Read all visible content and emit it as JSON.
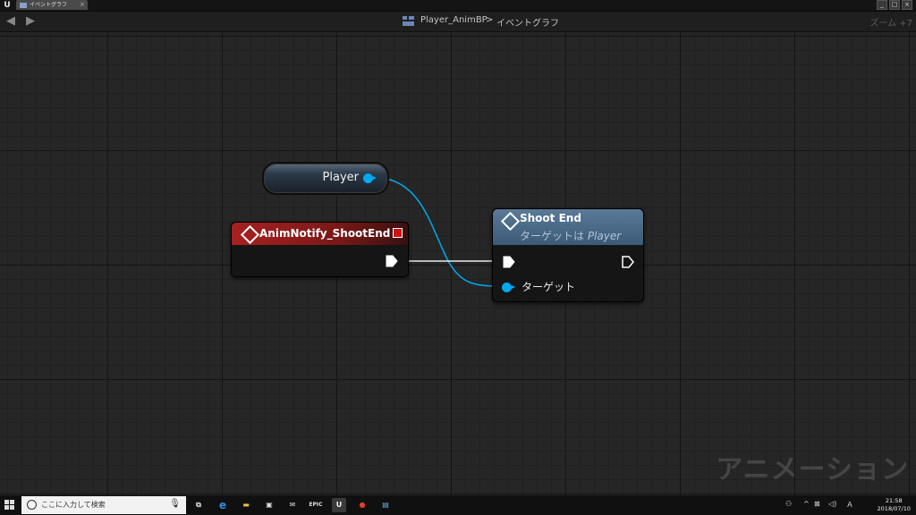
{
  "window": {
    "logo": "U",
    "tab_label": "イベントグラフ",
    "tab_close": "×",
    "buttons": [
      "_",
      "□",
      "×"
    ]
  },
  "breadcrumb": {
    "back": "◀",
    "forward": "▶",
    "asset": "Player_AnimBP",
    "separator": ">",
    "graph": "イベントグラフ",
    "zoom": "ズーム +7"
  },
  "graph": {
    "watermark": "アニメーション",
    "variable_node": {
      "label": "Player",
      "pin_color": "#00a8f0"
    },
    "event_node": {
      "title": "AnimNotify_ShootEnd",
      "header_color": "#a82020"
    },
    "function_node": {
      "title": "Shoot End",
      "subtitle_prefix": "ターゲットは",
      "subtitle_target": "Player",
      "target_pin_label": "ターゲット",
      "header_color": "#4a6a88"
    }
  },
  "taskbar": {
    "search_placeholder": "ここに入力して検索",
    "mic": "🎙",
    "apps": [
      {
        "name": "task-view",
        "glyph": "⧉"
      },
      {
        "name": "edge",
        "glyph": "e"
      },
      {
        "name": "explorer",
        "glyph": "▬"
      },
      {
        "name": "store",
        "glyph": "▣"
      },
      {
        "name": "mail",
        "glyph": "✉"
      },
      {
        "name": "epic",
        "glyph": "EPIC"
      },
      {
        "name": "unreal",
        "glyph": "U"
      },
      {
        "name": "chrome",
        "glyph": "●"
      },
      {
        "name": "notepad",
        "glyph": "▤"
      }
    ],
    "tray": {
      "people": "⚇",
      "chevron": "^",
      "network": "⊠",
      "volume": "◁)",
      "ime": "Ａ"
    },
    "clock_time": "21:58",
    "clock_date": "2018/07/10"
  }
}
